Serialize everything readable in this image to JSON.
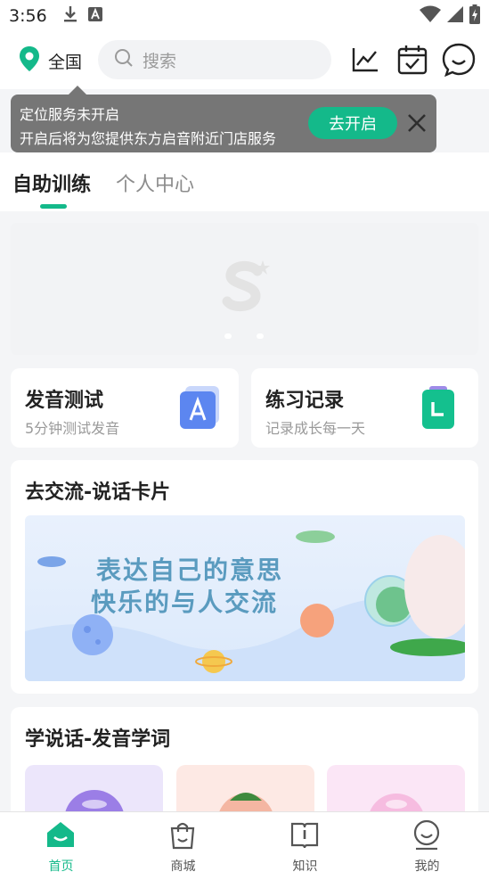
{
  "status_bar": {
    "time": "3:56",
    "left_icons": [
      "download-icon",
      "a-badge-icon"
    ],
    "right_icons": [
      "wifi-icon",
      "cellular-signal-icon",
      "battery-icon"
    ]
  },
  "header": {
    "location_label": "全国",
    "search_placeholder": "搜索",
    "icons": [
      "trend-chart-icon",
      "calendar-check-icon",
      "message-smile-icon"
    ]
  },
  "tooltip": {
    "title": "定位服务未开启",
    "description": "开启后将为您提供东方启音附近门店服务",
    "button_label": "去开启"
  },
  "tabs": [
    {
      "label": "自助训练",
      "active": true
    },
    {
      "label": "个人中心",
      "active": false
    }
  ],
  "quick_cards": [
    {
      "title": "发音测试",
      "subtitle": "5分钟测试发音",
      "icon": "letter-a-icon"
    },
    {
      "title": "练习记录",
      "subtitle": "记录成长每一天",
      "icon": "clipboard-record-icon"
    }
  ],
  "speaking_card": {
    "title": "去交流-说话卡片",
    "banner_line1": "表达自己的意思",
    "banner_line2": "快乐的与人交流"
  },
  "learn_section": {
    "title": "学说话-发音学词"
  },
  "bottom_nav": [
    {
      "label": "首页",
      "icon": "home-icon",
      "active": true
    },
    {
      "label": "商城",
      "icon": "shopping-bag-icon",
      "active": false
    },
    {
      "label": "知识",
      "icon": "book-icon",
      "active": false
    },
    {
      "label": "我的",
      "icon": "profile-smile-icon",
      "active": false
    }
  ],
  "colors": {
    "accent": "#14b98a",
    "tooltip_bg": "#767676",
    "page_bg": "#f4f5f7"
  }
}
